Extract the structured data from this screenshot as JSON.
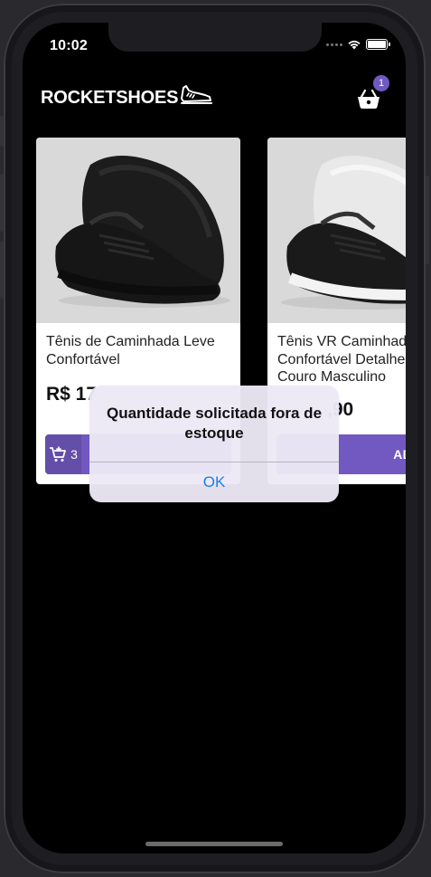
{
  "status_bar": {
    "time": "10:02"
  },
  "header": {
    "brand": "ROCKETSHOES",
    "cart_count": "1"
  },
  "products": [
    {
      "title": "Tênis de Caminhada Leve\nConfortável",
      "price": "R$ 17",
      "amount": "3",
      "add_label": ""
    },
    {
      "title": "Tênis VR Caminhad\nConfortável Detalhe\nCouro Masculino",
      "price": ",90",
      "amount": "",
      "add_label": "ADICIO"
    }
  ],
  "alert": {
    "message": "Quantidade solicitada fora de estoque",
    "ok_label": "OK"
  },
  "colors": {
    "accent": "#7159c1",
    "background": "#000000",
    "alert_button": "#1a7cf2"
  },
  "icons": [
    "sneaker-icon",
    "basket-icon",
    "cart-add-icon",
    "wifi-icon",
    "battery-icon"
  ]
}
